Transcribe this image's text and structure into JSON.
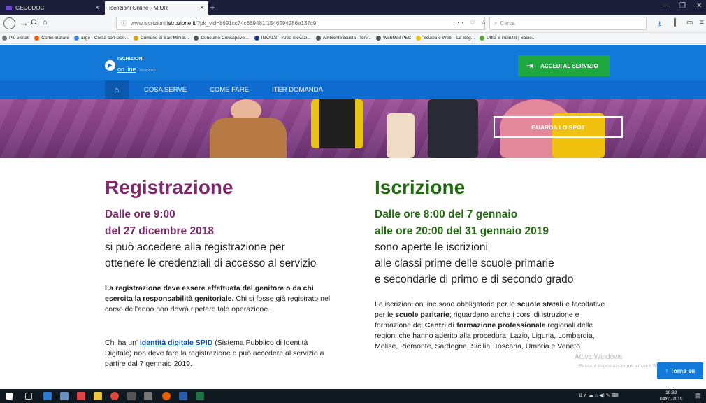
{
  "browser": {
    "tabs": [
      {
        "label": "GECODOC"
      },
      {
        "label": "Iscrizioni Online - MIUR"
      }
    ],
    "url": {
      "prefix": "www.iscrizioni.",
      "host": "istruzione.it",
      "path": "/?pk_vid=8691cc74c669481f1546594286e137c9"
    },
    "search_placeholder": "Cerca",
    "bookmarks": [
      {
        "label": "Più visitati",
        "color": "#777777"
      },
      {
        "label": "Come iniziare",
        "color": "#e66000"
      },
      {
        "label": "argo - Cerca con Goo...",
        "color": "#4285f4"
      },
      {
        "label": "Comune di San Miniat...",
        "color": "#d4a017"
      },
      {
        "label": "Consumo Consapevol...",
        "color": "#555555"
      },
      {
        "label": "INVALSI - Area rilevazi...",
        "color": "#1b3a8a"
      },
      {
        "label": "AmbienteScuola - Sini...",
        "color": "#555555"
      },
      {
        "label": "WebMail PEC",
        "color": "#555555"
      },
      {
        "label": "Scuola e Web – La Seg...",
        "color": "#f3c200"
      },
      {
        "label": "Uffici e indirizzi | Socie...",
        "color": "#5fa83a"
      }
    ]
  },
  "site": {
    "logo_line1": "ISCRIZIONI",
    "logo_line2": "on line",
    "logo_line3": "2019/2020",
    "accedi_label": "ACCEDI AL SERVIZIO",
    "nav": [
      {
        "label": "COSA SERVE"
      },
      {
        "label": "COME FARE"
      },
      {
        "label": "ITER DOMANDA"
      }
    ],
    "spot_label": "GUARDA LO SPOT"
  },
  "registrazione": {
    "title": "Registrazione",
    "date1": "Dalle ore 9:00",
    "date2": "del 27 dicembre 2018",
    "desc1": "si può accedere alla registrazione per",
    "desc2": "ottenere le credenziali di accesso al servizio",
    "p1_bold": "La registrazione deve essere effettuata dal genitore o da chi esercita la responsabilità genitoriale.",
    "p1_rest": " Chi si fosse già registrato nel corso dell'anno non dovrà ripetere tale operazione.",
    "p2_pre": "Chi ha un' ",
    "p2_link": "identità digitale SPID",
    "p2_rest": " (Sistema Pubblico di Identità Digitale) non deve fare la registrazione e può accedere al servizio a partire dal 7 gennaio 2019."
  },
  "iscrizione": {
    "title": "Iscrizione",
    "date1": "Dalle ore 8:00 del 7 gennaio",
    "date2": "alle ore 20:00 del 31 gennaio 2019",
    "desc1": "sono aperte le iscrizioni",
    "desc2": "alle classi prime delle scuole primarie",
    "desc3": "e secondarie di primo e di secondo grado",
    "p_a": "Le iscrizioni on line sono obbligatorie per le ",
    "p_b": "scuole statali",
    "p_c": " e facoltative per le ",
    "p_d": "scuole paritarie",
    "p_e": "; riguardano anche i corsi di istruzione e formazione dei ",
    "p_f": "Centri di formazione professionale",
    "p_g": " regionali delle regioni che hanno aderito alla procedura: Lazio, Liguria, Lombardia, Molise, Piemonte, Sardegna, Sicilia, Toscana, Umbria e Veneto."
  },
  "watermark": {
    "line1": "Attiva Windows",
    "line2": "Passa a Impostazioni per attivare Windows."
  },
  "torna_label": "Torna su",
  "clock": {
    "time": "10:32",
    "date": "04/01/2019"
  },
  "colors": {
    "registrazione": "#7c2a6a",
    "iscrizione": "#236b10",
    "accent": "#1379d9",
    "accedi": "#1fa83f"
  }
}
